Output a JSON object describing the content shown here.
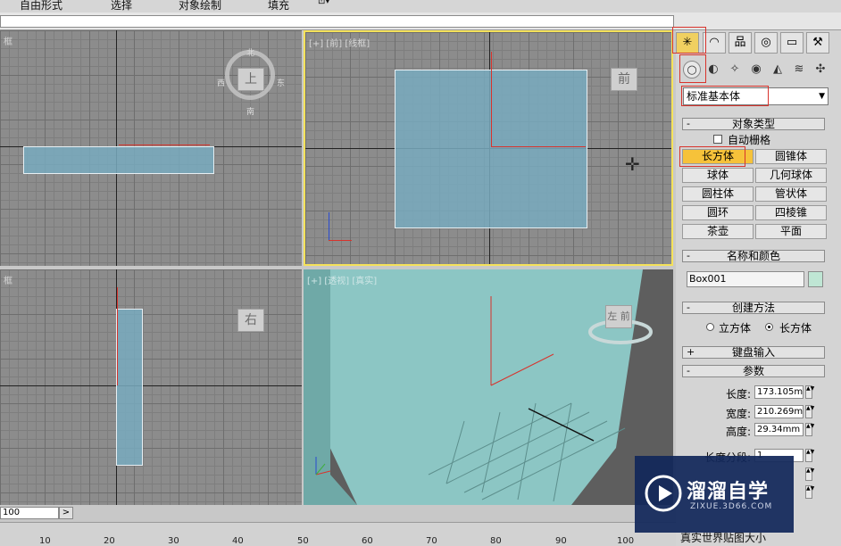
{
  "menu": [
    "自由形式",
    "选择",
    "对象绘制",
    "填充"
  ],
  "viewports": {
    "top_left_label": "框",
    "top_left_cube": "上",
    "top_left_compass": [
      "北",
      "西",
      "东",
      "南"
    ],
    "front_label": "[+] [前] [线框]",
    "front_cube": "前",
    "left_label": "框",
    "left_cube": "右",
    "persp_label": "[+] [透视] [真实]",
    "persp_cube": "左 前"
  },
  "panel": {
    "tabs": [
      "create-tab",
      "modify-tab",
      "hierarchy-tab",
      "motion-tab",
      "display-tab",
      "utilities-tab"
    ],
    "subicons": [
      "geometry-icon",
      "shapes-icon",
      "lights-icon",
      "cameras-icon",
      "helpers-icon",
      "spacewarps-icon",
      "systems-icon"
    ],
    "category": "标准基本体",
    "object_type": {
      "title": "对象类型",
      "autogrid": "自动栅格",
      "buttons": [
        "长方体",
        "圆锥体",
        "球体",
        "几何球体",
        "圆柱体",
        "管状体",
        "圆环",
        "四棱锥",
        "茶壶",
        "平面"
      ]
    },
    "name_color": {
      "title": "名称和颜色",
      "name": "Box001",
      "color": "#bfe6d4"
    },
    "creation_method": {
      "title": "创建方法",
      "options": [
        "立方体",
        "长方体"
      ],
      "selected": "长方体"
    },
    "keyboard": {
      "title": "键盘输入"
    },
    "params": {
      "title": "参数",
      "length_label": "长度:",
      "length": "173.105m",
      "width_label": "宽度:",
      "width": "210.269m",
      "height_label": "高度:",
      "height": "29.34mm",
      "lseg_label": "长度分段:",
      "lseg": "1"
    },
    "cut_text": "真实世界贴图大小"
  },
  "timeline": {
    "frame": "100",
    "next": ">",
    "ticks": [
      "10",
      "20",
      "30",
      "40",
      "50",
      "60",
      "70",
      "80",
      "90",
      "100"
    ]
  },
  "watermark": {
    "title": "溜溜自学",
    "url": "ZIXUE.3D66.COM"
  }
}
